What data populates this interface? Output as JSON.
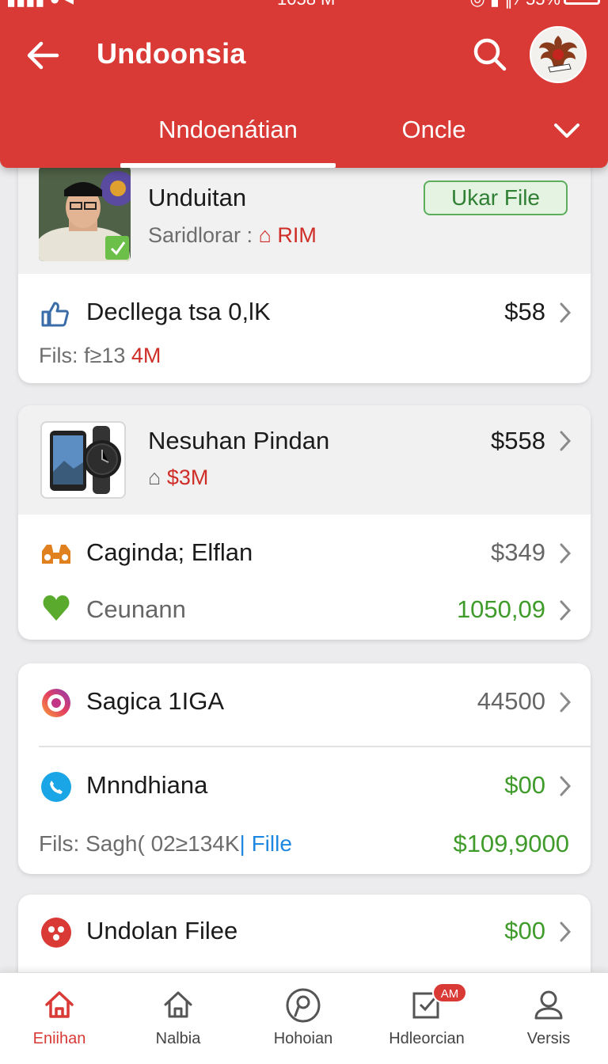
{
  "header": {
    "title": "Undoonsia",
    "tabs": [
      {
        "label": "Nndoenátian",
        "active": true
      },
      {
        "label": "Oncle",
        "active": false
      }
    ],
    "accent": "#d93a36"
  },
  "cards": [
    {
      "title": "Unduitan",
      "subtitle_prefix": "Saridlorar :",
      "subtitle_value": "RIM",
      "button_label": "Ukar File",
      "row_title": "Decllega tsa 0,lK",
      "row_price": "$58",
      "files_prefix": "Fils:",
      "files_value": "f≥13",
      "files_highlight": "4M"
    },
    {
      "title": "Nesuhan Pindan",
      "price": "$558",
      "sub_value": "$3M",
      "rows": [
        {
          "label": "Caginda; Elflan",
          "value": "$349"
        },
        {
          "label": "Ceunann",
          "value": "1050,09"
        }
      ]
    },
    {
      "rows": [
        {
          "label": "Sagica 1IGA",
          "value": "44500"
        },
        {
          "label": "Mnndhiana",
          "value": "$00"
        }
      ],
      "footer_prefix": "Fils:",
      "footer_value": "Sagh( 02≥134K",
      "footer_link": "Fille",
      "footer_amount": "$109,9000"
    },
    {
      "title": "Undolan Filee",
      "price": "$00"
    }
  ],
  "nav": [
    {
      "label": "Eniihan",
      "icon": "home-icon",
      "active": true
    },
    {
      "label": "Nalbia",
      "icon": "home-outline-icon",
      "active": false
    },
    {
      "label": "Hohoian",
      "icon": "location-icon",
      "active": false
    },
    {
      "label": "Hdleorcian",
      "icon": "checkbox-icon",
      "active": false,
      "badge": "AM"
    },
    {
      "label": "Versis",
      "icon": "user-icon",
      "active": false
    }
  ]
}
